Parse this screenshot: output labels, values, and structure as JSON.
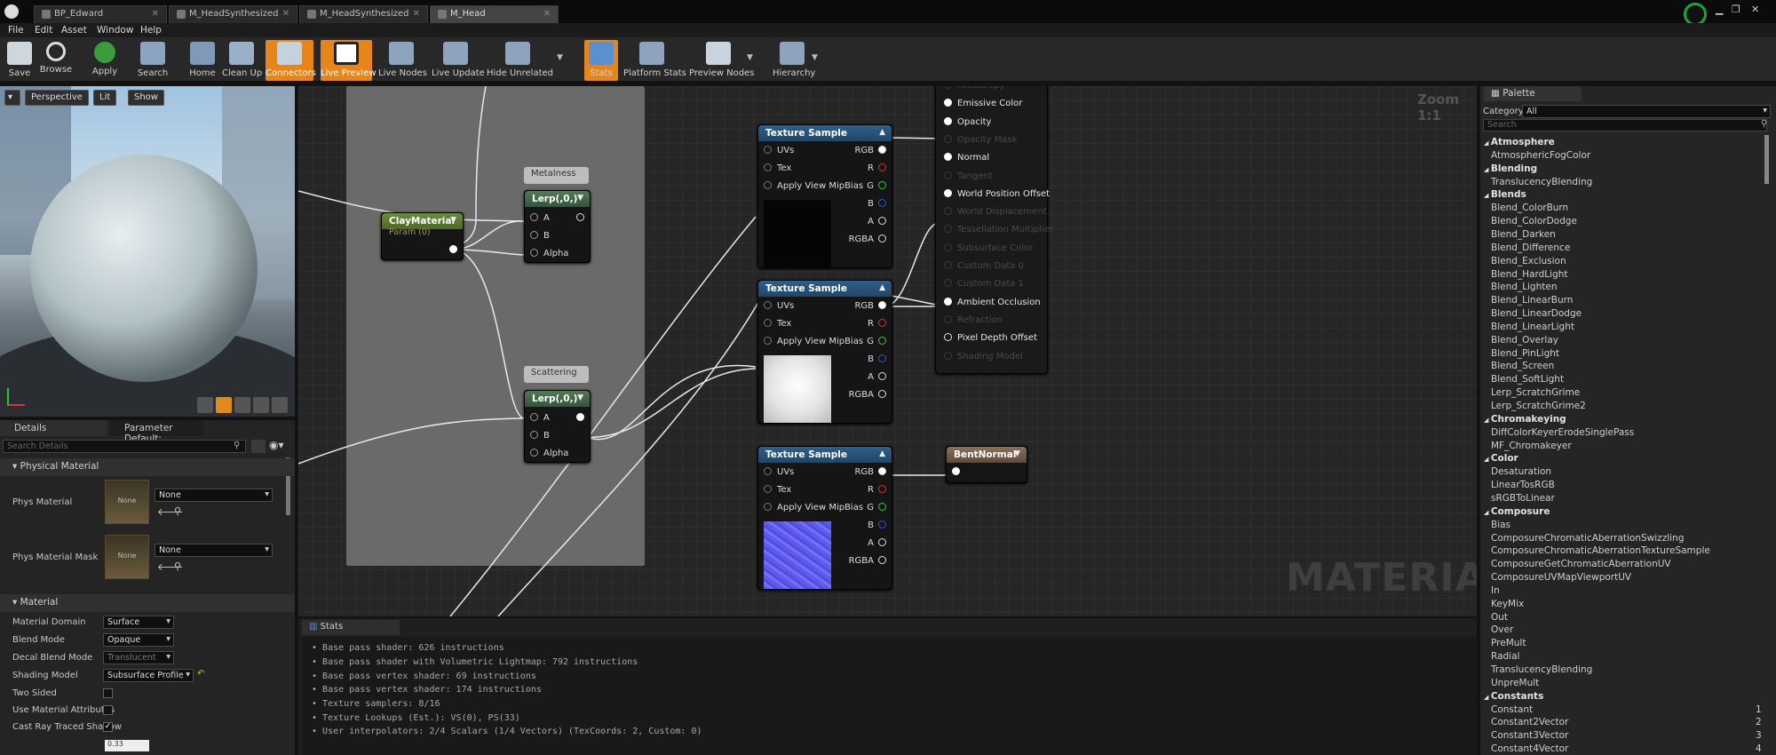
{
  "tabs": [
    "BP_Edward",
    "M_HeadSynthesized",
    "M_HeadSynthesized",
    "M_Head"
  ],
  "menu": [
    "File",
    "Edit",
    "Asset",
    "Window",
    "Help"
  ],
  "toolbar": [
    "Save",
    "Browse",
    "Apply",
    "Search",
    "Home",
    "Clean Up",
    "Connectors",
    "Live Preview",
    "Live Nodes",
    "Live Update",
    "Hide Unrelated",
    "Stats",
    "Platform Stats",
    "Preview Nodes",
    "Hierarchy"
  ],
  "viewport": {
    "perspective": "Perspective",
    "lit": "Lit",
    "show": "Show"
  },
  "details": {
    "tabs": [
      "Details",
      "Parameter Default:"
    ],
    "search_placeholder": "Search Details",
    "sections": [
      "Physical Material",
      "Material"
    ],
    "phys_material_label": "Phys Material",
    "phys_material_mask_label": "Phys Material Mask",
    "none": "None",
    "props": [
      {
        "label": "Material Domain",
        "value": "Surface"
      },
      {
        "label": "Blend Mode",
        "value": "Opaque"
      },
      {
        "label": "Decal Blend Mode",
        "value": "Translucent"
      },
      {
        "label": "Shading Model",
        "value": "Subsurface Profile"
      },
      {
        "label": "Two Sided",
        "value": ""
      },
      {
        "label": "Use Material Attributes",
        "value": ""
      },
      {
        "label": "Cast Ray Traced Shadow",
        "value": ""
      }
    ],
    "opacity_value": "0.33"
  },
  "graph": {
    "zoom": "Zoom 1:1",
    "watermark": "MATERIAL",
    "metalness_label": "Metalness",
    "scattering_label": "Scattering",
    "clay_title": "ClayMaterial",
    "clay_sub": "Param (0)",
    "lerp_title": "Lerp(,0,)",
    "lerp_pins": [
      "A",
      "B",
      "Alpha"
    ],
    "ts_title": "Texture Sample",
    "ts_in": [
      "UVs",
      "Tex",
      "Apply View MipBias"
    ],
    "ts_out": [
      "RGB",
      "R",
      "G",
      "B",
      "A",
      "RGBA"
    ],
    "bent_title": "BentNormal",
    "result_pins": [
      "Anisotropy",
      "Emissive Color",
      "Opacity",
      "Opacity Mask",
      "Normal",
      "Tangent",
      "World Position Offset",
      "World Displacement",
      "Tessellation Multiplier",
      "Subsurface Color",
      "Custom Data 0",
      "Custom Data 1",
      "Ambient Occlusion",
      "Refraction",
      "Pixel Depth Offset",
      "Shading Model"
    ]
  },
  "stats": {
    "tab": "Stats",
    "lines": [
      "Base pass shader: 626 instructions",
      "Base pass shader with Volumetric Lightmap: 792 instructions",
      "Base pass vertex shader: 69 instructions",
      "Base pass vertex shader: 174 instructions",
      "Texture samplers: 8/16",
      "Texture Lookups (Est.): VS(0), PS(33)",
      "User interpolators: 2/4 Scalars (1/4 Vectors) (TexCoords: 2, Custom: 0)"
    ]
  },
  "palette": {
    "tab": "Palette",
    "category_label": "Category:",
    "category_value": "All",
    "search_placeholder": "Search",
    "items": [
      {
        "t": "c",
        "name": "Atmosphere"
      },
      {
        "t": "i",
        "name": "AtmosphericFogColor"
      },
      {
        "t": "c",
        "name": "Blending"
      },
      {
        "t": "i",
        "name": "TranslucencyBlending"
      },
      {
        "t": "c",
        "name": "Blends"
      },
      {
        "t": "i",
        "name": "Blend_ColorBurn"
      },
      {
        "t": "i",
        "name": "Blend_ColorDodge"
      },
      {
        "t": "i",
        "name": "Blend_Darken"
      },
      {
        "t": "i",
        "name": "Blend_Difference"
      },
      {
        "t": "i",
        "name": "Blend_Exclusion"
      },
      {
        "t": "i",
        "name": "Blend_HardLight"
      },
      {
        "t": "i",
        "name": "Blend_Lighten"
      },
      {
        "t": "i",
        "name": "Blend_LinearBurn"
      },
      {
        "t": "i",
        "name": "Blend_LinearDodge"
      },
      {
        "t": "i",
        "name": "Blend_LinearLight"
      },
      {
        "t": "i",
        "name": "Blend_Overlay"
      },
      {
        "t": "i",
        "name": "Blend_PinLight"
      },
      {
        "t": "i",
        "name": "Blend_Screen"
      },
      {
        "t": "i",
        "name": "Blend_SoftLight"
      },
      {
        "t": "i",
        "name": "Lerp_ScratchGrime"
      },
      {
        "t": "i",
        "name": "Lerp_ScratchGrime2"
      },
      {
        "t": "c",
        "name": "Chromakeying"
      },
      {
        "t": "i",
        "name": "DiffColorKeyerErodeSinglePass"
      },
      {
        "t": "i",
        "name": "MF_Chromakeyer"
      },
      {
        "t": "c",
        "name": "Color"
      },
      {
        "t": "i",
        "name": "Desaturation"
      },
      {
        "t": "i",
        "name": "LinearTosRGB"
      },
      {
        "t": "i",
        "name": "sRGBToLinear"
      },
      {
        "t": "c",
        "name": "Composure"
      },
      {
        "t": "i",
        "name": "Bias"
      },
      {
        "t": "i",
        "name": "ComposureChromaticAberrationSwizzling"
      },
      {
        "t": "i",
        "name": "ComposureChromaticAberrationTextureSample"
      },
      {
        "t": "i",
        "name": "ComposureGetChromaticAberrationUV"
      },
      {
        "t": "i",
        "name": "ComposureUVMapViewportUV"
      },
      {
        "t": "i",
        "name": "In"
      },
      {
        "t": "i",
        "name": "KeyMix"
      },
      {
        "t": "i",
        "name": "Out"
      },
      {
        "t": "i",
        "name": "Over"
      },
      {
        "t": "i",
        "name": "PreMult"
      },
      {
        "t": "i",
        "name": "Radial"
      },
      {
        "t": "i",
        "name": "TranslucencyBlending"
      },
      {
        "t": "i",
        "name": "UnpreMult"
      },
      {
        "t": "c",
        "name": "Constants"
      },
      {
        "t": "i",
        "name": "Constant",
        "k": "1"
      },
      {
        "t": "i",
        "name": "Constant2Vector",
        "k": "2"
      },
      {
        "t": "i",
        "name": "Constant3Vector",
        "k": "3"
      },
      {
        "t": "i",
        "name": "Constant4Vector",
        "k": "4"
      }
    ]
  }
}
